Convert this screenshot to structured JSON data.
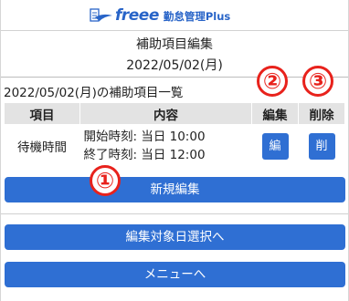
{
  "brand": {
    "logo_text": "freee",
    "logo_subtitle": "勤怠管理Plus",
    "accent_color": "#2864c8"
  },
  "header": {
    "title": "補助項目編集",
    "date": "2022/05/02(月)"
  },
  "section": {
    "title": "2022/05/02(月)の補助項目一覧"
  },
  "table": {
    "columns": [
      "項目",
      "内容",
      "編集",
      "削除"
    ],
    "rows": [
      {
        "name": "待機時間",
        "detail_line1": "開始時刻: 当日 10:00",
        "detail_line2": "終了時刻: 当日 12:00",
        "edit_label": "編",
        "delete_label": "削"
      }
    ]
  },
  "buttons": {
    "new_edit": "新規編集",
    "select_date": "編集対象日選択へ",
    "menu": "メニューへ",
    "color": "#2f6fd3"
  },
  "annotations": {
    "badge1": "①",
    "badge2": "②",
    "badge3": "③",
    "color": "#e8221c"
  }
}
